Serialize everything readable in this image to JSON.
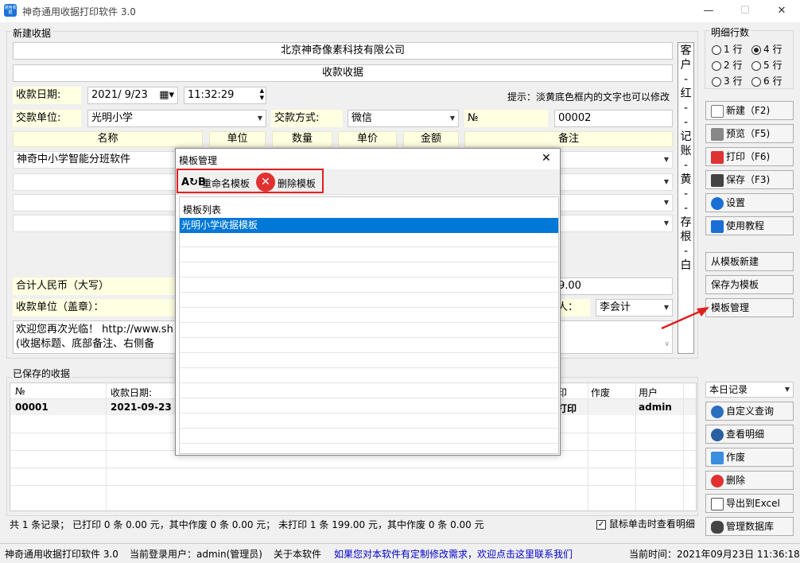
{
  "window": {
    "title": "神奇通用收据打印软件 3.0",
    "app_icon_text": "通用收据",
    "minimize": "—",
    "maximize": "☐",
    "close": "✕"
  },
  "new_receipt": {
    "group_label": "新建收据",
    "company": "北京神奇像素科技有限公司",
    "receipt_title": "收款收据",
    "date_label": "收款日期:",
    "date_value": "2021/ 9/23",
    "time_value": "11:32:29",
    "hint": "提示：淡黄底色框内的文字也可以修改",
    "payer_label": "交款单位:",
    "payer_value": "光明小学",
    "method_label": "交款方式:",
    "method_value": "微信",
    "no_label": "№",
    "no_value": "00002",
    "columns": [
      "名称",
      "单位",
      "数量",
      "单价",
      "金额",
      "备注"
    ],
    "first_item": "神奇中小学智能分班软件",
    "total_label": "合计人民币（大写）",
    "total_amount": "9.00",
    "stamp_label": "收款单位（盖章）：",
    "handler_suffix": "人：",
    "handler_value": "李会计",
    "note_line1": "欢迎您再次光临！ http://www.sh",
    "note_line2": "(收据标题、底部备注、右侧备"
  },
  "side_copy": [
    "客",
    "户",
    "-",
    "红",
    "-",
    "-",
    "记",
    "账",
    "-",
    "黄",
    "-",
    "-",
    "存",
    "根",
    "-",
    "白"
  ],
  "detail_rows": {
    "label": "明细行数",
    "options": [
      {
        "text": "1 行",
        "on": false
      },
      {
        "text": "4 行",
        "on": true
      },
      {
        "text": "2 行",
        "on": false
      },
      {
        "text": "5 行",
        "on": false
      },
      {
        "text": "3 行",
        "on": false
      },
      {
        "text": "6 行",
        "on": false
      }
    ]
  },
  "right_buttons": {
    "new": "新建（F2)",
    "preview": "预览（F5)",
    "print": "打印（F6)",
    "save": "保存（F3)",
    "settings": "设置",
    "tutorial": "使用教程",
    "from_template": "从模板新建",
    "save_template": "保存为模板",
    "manage_template": "模板管理"
  },
  "saved": {
    "group_label": "已保存的收据",
    "columns": [
      "№",
      "收款日期:",
      "印",
      "作废",
      "用户"
    ],
    "row": {
      "no": "00001",
      "date": "2021-09-23 (",
      "print": "打印",
      "void": "",
      "user": "admin"
    },
    "filter_value": "本日记录",
    "summary": "共 1 条记录；   已打印 0 条 0.00 元，其中作废 0 条 0.00 元；   未打印 1 条 199.00 元，其中作废 0 条 0.00 元",
    "checkbox_label": "鼠标单击时查看明细"
  },
  "saved_buttons": {
    "query": "自定义查询",
    "view": "查看明细",
    "void": "作废",
    "delete": "删除",
    "export": "导出到Excel",
    "db": "管理数据库"
  },
  "status": {
    "app": "神奇通用收据打印软件 3.0",
    "user": "当前登录用户：admin(管理员)",
    "about": "关于本软件",
    "custom": "如果您对本软件有定制修改需求，欢迎点击这里联系我们",
    "time": "当前时间：2021年09月23日  11:36:18"
  },
  "dialog": {
    "title": "模板管理",
    "close": "✕",
    "rename": "重命名模板",
    "delete": "删除模板",
    "list_header": "模板列表",
    "items": [
      "光明小学收据模板"
    ]
  },
  "colors": {
    "accent": "#0078d7",
    "yellow_field": "#ffffe1",
    "highlight_box": "#e02020",
    "arrow": "#e02020",
    "link": "#0000cc"
  }
}
